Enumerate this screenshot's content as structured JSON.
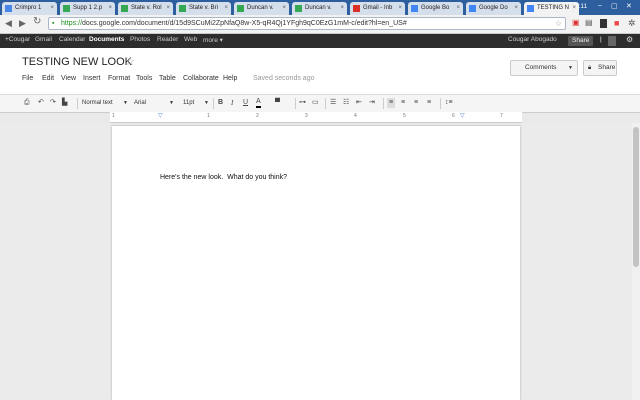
{
  "browser": {
    "tabs": [
      {
        "label": "Crimpro 1",
        "color": "#4a86e8"
      },
      {
        "label": "Supp 1 2.p",
        "color": "#34a853"
      },
      {
        "label": "State v. Rol",
        "color": "#34a853"
      },
      {
        "label": "State v. Bri",
        "color": "#34a853"
      },
      {
        "label": "Duncan v.",
        "color": "#34a853"
      },
      {
        "label": "Duncan v.",
        "color": "#34a853"
      },
      {
        "label": "Gmail - Inb",
        "color": "#d93025"
      },
      {
        "label": "Google Bo",
        "color": "#4285f4"
      },
      {
        "label": "Google Do",
        "color": "#4285f4"
      },
      {
        "label": "TESTING N",
        "color": "#4285f4"
      }
    ],
    "clock": "3:11",
    "url_scheme": "https://",
    "url_rest": "docs.google.com/document/d/15d9SCuMi2ZpNfaQ8w-X5-qR4Qj1YFgh9qC0EzG1mM-c/edit?hl=en_US#"
  },
  "gbar": {
    "items": [
      "+Cougar",
      "Gmail",
      "Calendar",
      "Documents",
      "Photos",
      "Reader",
      "Web",
      "more ▾"
    ],
    "user": "Cougar Abogado",
    "share": "Share"
  },
  "doc": {
    "title": "TESTING NEW LOOK",
    "menus": [
      "File",
      "Edit",
      "View",
      "Insert",
      "Format",
      "Tools",
      "Table",
      "Collaborate",
      "Help"
    ],
    "saved": "Saved seconds ago",
    "comments_btn": "Comments",
    "share_btn": "Share",
    "body": "Here's the new look.  What do you think?"
  },
  "toolbar": {
    "style": "Normal text",
    "font": "Arial",
    "size": "11pt"
  },
  "ruler": {
    "numbers": [
      "1",
      "1",
      "2",
      "3",
      "4",
      "5",
      "6",
      "7"
    ]
  }
}
